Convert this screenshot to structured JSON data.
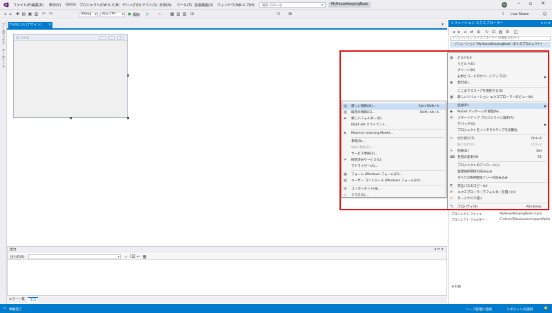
{
  "title_bar": {
    "menus": [
      "ファイル(F)",
      "編集(E)",
      "表示(V)",
      "Git(G)",
      "プロジェクト(P)",
      "ビルド(B)",
      "デバッグ(D)",
      "テスト(S)",
      "分析(N)",
      "ツール(T)",
      "拡張機能(X)",
      "ウィンドウ(W)",
      "ヘルプ(H)"
    ],
    "search_placeholder": "検索 (Ctrl+Q)",
    "solution_name": "MyHouseKeepingBook",
    "avatar_initials": "YA"
  },
  "toolbar": {
    "config": "Debug",
    "platform": "Any CPU",
    "start_label": "開始",
    "live_share": "Live Share"
  },
  "left_strip": [
    "ツールボックス",
    "データソース"
  ],
  "document": {
    "tab_title": "Form1.cs [デザイン]",
    "tab_close": "×",
    "form_title": "Form1",
    "form_buttons": [
      "─",
      "□",
      "×"
    ]
  },
  "output": {
    "title": "出力",
    "label": "出力元(S):",
    "tabs": [
      "エラー一覧",
      "出力"
    ]
  },
  "solution_explorer": {
    "title": "ソリューション エクスプローラー",
    "search_placeholder": "ソリューション エクスプローラー の検索 (Ctrl+;)",
    "root": "ソリューション 'MyHouseKeepingBook' (1/1 のプロジェクト)",
    "props": [
      {
        "label": "プロジェクト ファイル",
        "value": "MyHouseKeepingBook.csproj"
      },
      {
        "label": "プロジェクト フォルダー",
        "value": "C:\\Users\\Tetsu\\source\\repos\\MyHo"
      }
    ],
    "other_label": "その他"
  },
  "context_menu": {
    "items": [
      {
        "label": "ビルド(U)",
        "shortcut": "",
        "icon": "build-icon"
      },
      {
        "label": "リビルド(E)",
        "shortcut": "",
        "icon": ""
      },
      {
        "label": "クリーン(N)",
        "shortcut": "",
        "icon": ""
      },
      {
        "label": "分析とコードのクリーンアップ(Z)",
        "shortcut": "",
        "icon": "",
        "submenu": true
      },
      {
        "label": "発行(B)...",
        "shortcut": "",
        "icon": "publish-icon"
      },
      {
        "sep": true
      },
      {
        "label": "ここまでスコープを限定する(S)",
        "shortcut": "",
        "icon": ""
      },
      {
        "label": "新しいソリューション エクスプローラーのビュー(N)",
        "shortcut": "",
        "icon": "new-view-icon"
      },
      {
        "sep": true
      },
      {
        "label": "追加(D)",
        "shortcut": "",
        "icon": "",
        "submenu": true,
        "highlight": true
      },
      {
        "label": "NuGet パッケージの管理(N)...",
        "shortcut": "",
        "icon": "nuget-icon"
      },
      {
        "label": "スタートアップ プロジェクトに設定(A)",
        "shortcut": "",
        "icon": "gear-icon"
      },
      {
        "label": "デバッグ(G)",
        "shortcut": "",
        "icon": "",
        "submenu": true
      },
      {
        "label": "プロジェクトをインタラクティブを初期化",
        "shortcut": "",
        "icon": ""
      },
      {
        "sep": true
      },
      {
        "label": "切り取り(T)",
        "shortcut": "Ctrl+X",
        "icon": "cut-icon"
      },
      {
        "label": "貼り付け(P)",
        "shortcut": "Ctrl+V",
        "icon": "",
        "disabled": true
      },
      {
        "label": "削除(D)",
        "shortcut": "Del",
        "icon": "delete-icon"
      },
      {
        "label": "名前の変更(M)",
        "shortcut": "F2",
        "icon": "rename-icon"
      },
      {
        "sep": true
      },
      {
        "label": "プロジェクトのアンロード(L)",
        "shortcut": "",
        "icon": ""
      },
      {
        "label": "直接依存関係の読み込み",
        "shortcut": "",
        "icon": ""
      },
      {
        "label": "すべての依存関係ツリーの読み込み",
        "shortcut": "",
        "icon": ""
      },
      {
        "sep": true
      },
      {
        "label": "完全パスのコピー(U)",
        "shortcut": "",
        "icon": "copy-icon"
      },
      {
        "label": "エクスプローラーでフォルダーを開く(X)",
        "shortcut": "",
        "icon": "folder-open-icon"
      },
      {
        "label": "ターミナルで開く",
        "shortcut": "",
        "icon": "terminal-icon"
      },
      {
        "sep": true
      },
      {
        "label": "プロパティ(R)",
        "shortcut": "Alt+Enter",
        "icon": "wrench-icon"
      }
    ]
  },
  "add_submenu": {
    "items": [
      {
        "label": "新しい項目(W)...",
        "shortcut": "Ctrl+Shift+A",
        "icon": "new-item-icon",
        "highlight": true
      },
      {
        "label": "既存の項目(G)...",
        "shortcut": "Shift+Alt+A",
        "icon": "existing-item-icon"
      },
      {
        "label": "新しいフォルダー(D)",
        "shortcut": "",
        "icon": "folder-icon"
      },
      {
        "label": "REST API クライアント...",
        "shortcut": "",
        "icon": ""
      },
      {
        "sep": true
      },
      {
        "label": "Machine Learning Model...",
        "shortcut": "",
        "icon": "ml-icon"
      },
      {
        "sep": true
      },
      {
        "label": "参照(R)...",
        "shortcut": "",
        "icon": ""
      },
      {
        "label": "Web 参照(E)...",
        "shortcut": "",
        "icon": "",
        "disabled": true
      },
      {
        "label": "サービス参照(S)...",
        "shortcut": "",
        "icon": ""
      },
      {
        "label": "接続済みサービス(C)",
        "shortcut": "",
        "icon": "connected-service-icon"
      },
      {
        "label": "アナライザー(A)...",
        "shortcut": "",
        "icon": ""
      },
      {
        "sep": true
      },
      {
        "label": "フォーム (Windows フォーム)(F)...",
        "shortcut": "",
        "icon": "form-icon"
      },
      {
        "label": "ユーザー コントロール (Windows フォーム)(U)...",
        "shortcut": "",
        "icon": "user-control-icon"
      },
      {
        "sep": true
      },
      {
        "label": "コンポーネント(N)...",
        "shortcut": "",
        "icon": "component-icon"
      },
      {
        "label": "クラス(C)...",
        "shortcut": "",
        "icon": "class-icon"
      }
    ]
  },
  "status_bar": {
    "ready": "準備完了",
    "source_control": "ソース管理に追加",
    "repo": "リポジトリの選択"
  }
}
